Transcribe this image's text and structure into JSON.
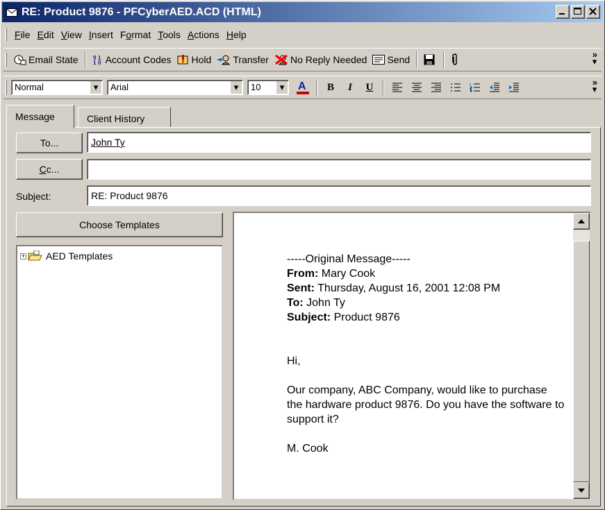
{
  "window": {
    "title": "RE: Product 9876 - PFCyberAED.ACD (HTML)"
  },
  "menu": {
    "items": [
      "File",
      "Edit",
      "View",
      "Insert",
      "Format",
      "Tools",
      "Actions",
      "Help"
    ],
    "accel": [
      "F",
      "E",
      "V",
      "I",
      "o",
      "T",
      "A",
      "H"
    ]
  },
  "toolbar": {
    "email_state": "Email State",
    "account_codes": "Account Codes",
    "hold": "Hold",
    "transfer": "Transfer",
    "no_reply": "No Reply Needed",
    "send": "Send",
    "chevron": "»"
  },
  "format_toolbar": {
    "style_value": "Normal",
    "font_value": "Arial",
    "size_value": "10",
    "font_color": "#cc0000",
    "bold": "B",
    "italic": "I",
    "underline": "U"
  },
  "tabs": {
    "message": "Message",
    "client_history": "Client History"
  },
  "form": {
    "to_button": "To...",
    "to_value": "John Ty",
    "cc_button": "Cc...",
    "cc_value": "",
    "subject_label": "Subject:",
    "subject_value": "RE: Product 9876"
  },
  "templates": {
    "button": "Choose Templates",
    "tree_root": "AED Templates",
    "expander": "+"
  },
  "message": {
    "separator": "-----Original Message-----",
    "from_label": "From:",
    "from_value": "Mary Cook",
    "sent_label": "Sent:",
    "sent_value": "Thursday, August 16, 2001 12:08 PM",
    "to_label": "To:",
    "to_value": "John Ty",
    "subject_label": "Subject:",
    "subject_value": "Product 9876",
    "greeting": "Hi,",
    "body": "Our company, ABC Company, would like to purchase the hardware product 9876. Do you have the software to support it?",
    "signature": "M. Cook"
  }
}
